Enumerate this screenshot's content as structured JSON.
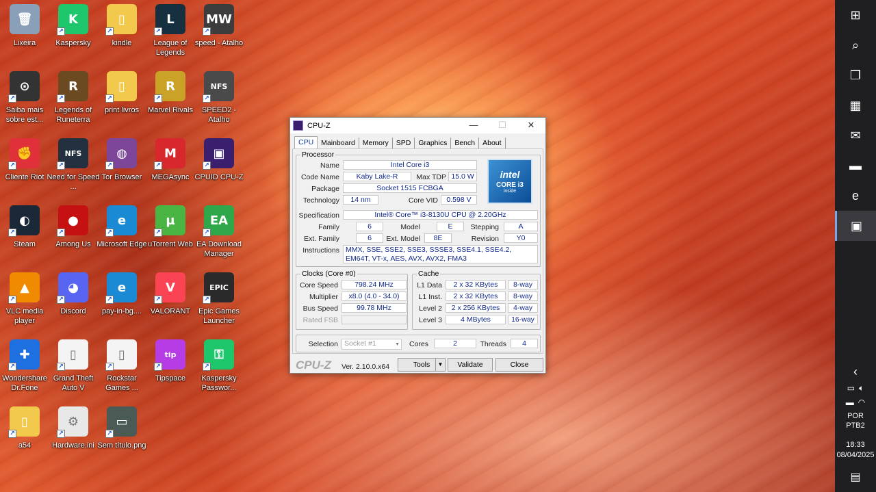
{
  "desktop": {
    "icons": [
      {
        "label": "Lixeira",
        "glyph": "🗑",
        "color": "#8aa0b8"
      },
      {
        "label": "Kaspersky",
        "glyph": "K",
        "color": "#1ec76b"
      },
      {
        "label": "kindle",
        "glyph": "▯",
        "color": "#f2c94c"
      },
      {
        "label": "League of Legends",
        "glyph": "L",
        "color": "#163040"
      },
      {
        "label": "speed - Atalho",
        "glyph": "MW",
        "color": "#3c3c3c"
      },
      {
        "label": "Saiba mais sobre est...",
        "glyph": "⊙",
        "color": "#333333"
      },
      {
        "label": "Legends of Runeterra",
        "glyph": "R",
        "color": "#6b4a22"
      },
      {
        "label": "print livros",
        "glyph": "▯",
        "color": "#f2c94c"
      },
      {
        "label": "Marvel Rivals",
        "glyph": "R",
        "color": "#c9a227"
      },
      {
        "label": "SPEED2 - Atalho",
        "glyph": "NFS",
        "color": "#4a4a4a"
      },
      {
        "label": "Cliente Riot",
        "glyph": "✊",
        "color": "#e0303a"
      },
      {
        "label": "Need for Speed ...",
        "glyph": "NFS",
        "color": "#233040"
      },
      {
        "label": "Tor Browser",
        "glyph": "◍",
        "color": "#7d4698"
      },
      {
        "label": "MEGAsync",
        "glyph": "M",
        "color": "#d9272e"
      },
      {
        "label": "CPUID CPU-Z",
        "glyph": "▣",
        "color": "#3a1f6e"
      },
      {
        "label": "Steam",
        "glyph": "◐",
        "color": "#1b2838"
      },
      {
        "label": "Among Us",
        "glyph": "●",
        "color": "#c51111"
      },
      {
        "label": "Microsoft Edge",
        "glyph": "e",
        "color": "#1a8ad4"
      },
      {
        "label": "uTorrent Web",
        "glyph": "µ",
        "color": "#4bb543"
      },
      {
        "label": "EA Download Manager",
        "glyph": "EA",
        "color": "#2ea84a"
      },
      {
        "label": "VLC media player",
        "glyph": "▲",
        "color": "#f08a00"
      },
      {
        "label": "Discord",
        "glyph": "◕",
        "color": "#5865f2"
      },
      {
        "label": "pay-in-bg....",
        "glyph": "e",
        "color": "#1a8ad4"
      },
      {
        "label": "VALORANT",
        "glyph": "V",
        "color": "#fa4454"
      },
      {
        "label": "Epic Games Launcher",
        "glyph": "EPIC",
        "color": "#2a2a2a"
      },
      {
        "label": "Wondershare Dr.Fone",
        "glyph": "✚",
        "color": "#1e6fe0"
      },
      {
        "label": "Grand Theft Auto V",
        "glyph": "▯",
        "color": "#f4f4f4"
      },
      {
        "label": "Rockstar Games ...",
        "glyph": "▯",
        "color": "#f4f4f4"
      },
      {
        "label": "Tipspace",
        "glyph": "tip",
        "color": "#b63ce6"
      },
      {
        "label": "Kaspersky Passwor...",
        "glyph": "⚿",
        "color": "#1ec76b"
      },
      {
        "label": "a54",
        "glyph": "▯",
        "color": "#f2c94c"
      },
      {
        "label": "Hardware.ini",
        "glyph": "⚙",
        "color": "#e8e8e8"
      },
      {
        "label": "Sem título.png",
        "glyph": "▭",
        "color": "#4a5a55"
      }
    ]
  },
  "taskbar": {
    "items": [
      {
        "name": "start-button",
        "icon": "windows-icon",
        "glyph": "⊞"
      },
      {
        "name": "search-button",
        "icon": "search-icon",
        "glyph": "⌕"
      },
      {
        "name": "task-view-button",
        "icon": "task-view-icon",
        "glyph": "❐"
      },
      {
        "name": "store-button",
        "icon": "store-icon",
        "glyph": "▦"
      },
      {
        "name": "outlook-button",
        "icon": "outlook-icon",
        "glyph": "✉"
      },
      {
        "name": "explorer-button",
        "icon": "folder-icon",
        "glyph": "▬"
      },
      {
        "name": "edge-button",
        "icon": "edge-icon",
        "glyph": "e"
      },
      {
        "name": "cpuz-button",
        "icon": "cpuz-icon",
        "glyph": "▣"
      }
    ],
    "tray": {
      "chevron": "‹",
      "lang1": "POR",
      "lang2": "PTB2",
      "time": "18:33",
      "date": "08/04/2025",
      "notif": "▤"
    }
  },
  "cpuz": {
    "title": "CPU-Z",
    "tabs": [
      "CPU",
      "Mainboard",
      "Memory",
      "SPD",
      "Graphics",
      "Bench",
      "About"
    ],
    "processor": {
      "group": "Processor",
      "name_label": "Name",
      "name": "Intel Core i3",
      "codename_label": "Code Name",
      "codename": "Kaby Lake-R",
      "maxtdp_label": "Max TDP",
      "maxtdp": "15.0 W",
      "package_label": "Package",
      "package": "Socket 1515 FCBGA",
      "tech_label": "Technology",
      "tech": "14 nm",
      "vid_label": "Core VID",
      "vid": "0.598 V",
      "spec_label": "Specification",
      "spec": "Intel® Core™ i3-8130U CPU @ 2.20GHz",
      "family_label": "Family",
      "family": "6",
      "model_label": "Model",
      "model": "E",
      "stepping_label": "Stepping",
      "stepping": "A",
      "extfamily_label": "Ext. Family",
      "extfamily": "6",
      "extmodel_label": "Ext. Model",
      "extmodel": "8E",
      "revision_label": "Revision",
      "revision": "Y0",
      "instr_label": "Instructions",
      "instr": "MMX, SSE, SSE2, SSE3, SSSE3, SSE4.1, SSE4.2, EM64T, VT-x, AES, AVX, AVX2, FMA3",
      "logo_brand": "intel",
      "logo_model": "CORE i3",
      "logo_sub": "inside"
    },
    "clocks": {
      "group": "Clocks (Core #0)",
      "speed_label": "Core Speed",
      "speed": "798.24 MHz",
      "mult_label": "Multiplier",
      "mult": "x8.0 (4.0 - 34.0)",
      "bus_label": "Bus Speed",
      "bus": "99.78 MHz",
      "fsb_label": "Rated FSB",
      "fsb": ""
    },
    "cache": {
      "group": "Cache",
      "l1d_label": "L1 Data",
      "l1d": "2 x 32 KBytes",
      "l1d_way": "8-way",
      "l1i_label": "L1 Inst.",
      "l1i": "2 x 32 KBytes",
      "l1i_way": "8-way",
      "l2_label": "Level 2",
      "l2": "2 x 256 KBytes",
      "l2_way": "4-way",
      "l3_label": "Level 3",
      "l3": "4 MBytes",
      "l3_way": "16-way"
    },
    "selection": {
      "label": "Selection",
      "value": "Socket #1",
      "cores_label": "Cores",
      "cores": "2",
      "threads_label": "Threads",
      "threads": "4"
    },
    "footer": {
      "logo": "CPU-Z",
      "version": "Ver. 2.10.0.x64",
      "tools": "Tools",
      "validate": "Validate",
      "close": "Close"
    }
  }
}
